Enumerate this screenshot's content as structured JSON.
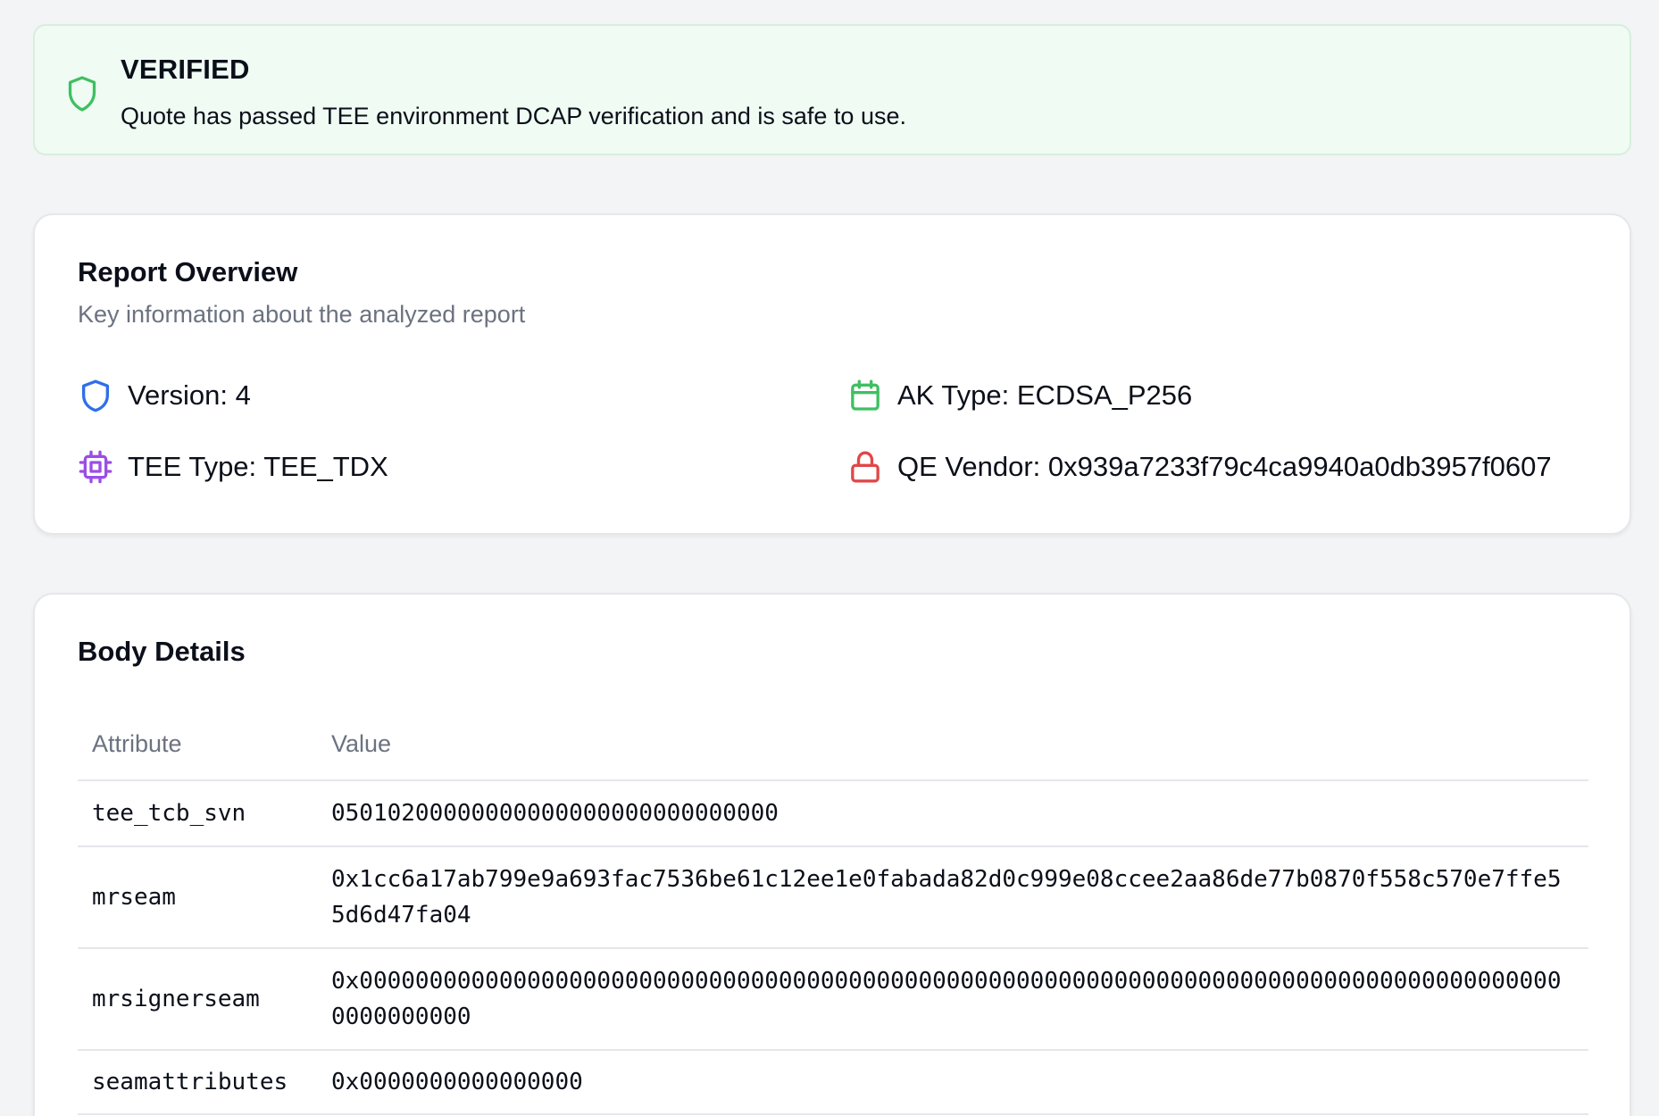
{
  "status": {
    "title": "VERIFIED",
    "description": "Quote has passed TEE environment DCAP verification and is safe to use.",
    "icon": "shield-check-icon",
    "color": "#3fbf62"
  },
  "overview": {
    "title": "Report Overview",
    "subtitle": "Key information about the analyzed report",
    "items": [
      {
        "label": "Version: 4",
        "icon": "shield-icon",
        "color": "#2f6fe8"
      },
      {
        "label": "AK Type: ECDSA_P256",
        "icon": "calendar-icon",
        "color": "#3fbf62"
      },
      {
        "label": "TEE Type: TEE_TDX",
        "icon": "cpu-icon",
        "color": "#9b4ee6"
      },
      {
        "label": "QE Vendor: 0x939a7233f79c4ca9940a0db3957f0607",
        "icon": "lock-icon",
        "color": "#e04848"
      }
    ]
  },
  "body_details": {
    "title": "Body Details",
    "columns": [
      "Attribute",
      "Value"
    ],
    "rows": [
      {
        "attribute": "tee_tcb_svn",
        "value": "05010200000000000000000000000000"
      },
      {
        "attribute": "mrseam",
        "value": "0x1cc6a17ab799e9a693fac7536be61c12ee1e0fabada82d0c999e08ccee2aa86de77b0870f558c570e7ffe55d6d47fa04"
      },
      {
        "attribute": "mrsignerseam",
        "value": "0x000000000000000000000000000000000000000000000000000000000000000000000000000000000000000000000000"
      },
      {
        "attribute": "seamattributes",
        "value": "0x0000000000000000"
      }
    ]
  }
}
